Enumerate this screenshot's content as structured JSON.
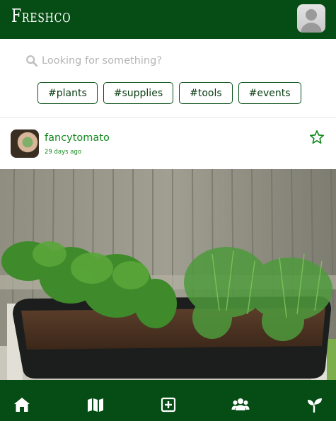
{
  "header": {
    "brand": "Freshco",
    "profile_icon": "user-avatar-icon"
  },
  "search": {
    "placeholder": "Looking for something?",
    "icon": "search-icon"
  },
  "tags": [
    "#plants",
    "#supplies",
    "#tools",
    "#events"
  ],
  "post": {
    "username": "fancytomato",
    "timestamp": "29 days ago",
    "favorite_icon": "star-icon",
    "image_subject": "garden-planter-photo"
  },
  "bottom_nav": [
    {
      "icon": "home-icon"
    },
    {
      "icon": "map-icon"
    },
    {
      "icon": "add-post-icon"
    },
    {
      "icon": "community-icon"
    },
    {
      "icon": "sprout-icon"
    }
  ],
  "colors": {
    "brand_green": "#054d14",
    "accent_green": "#148a1e",
    "tag_border": "#054d14",
    "background": "#ffffff"
  }
}
